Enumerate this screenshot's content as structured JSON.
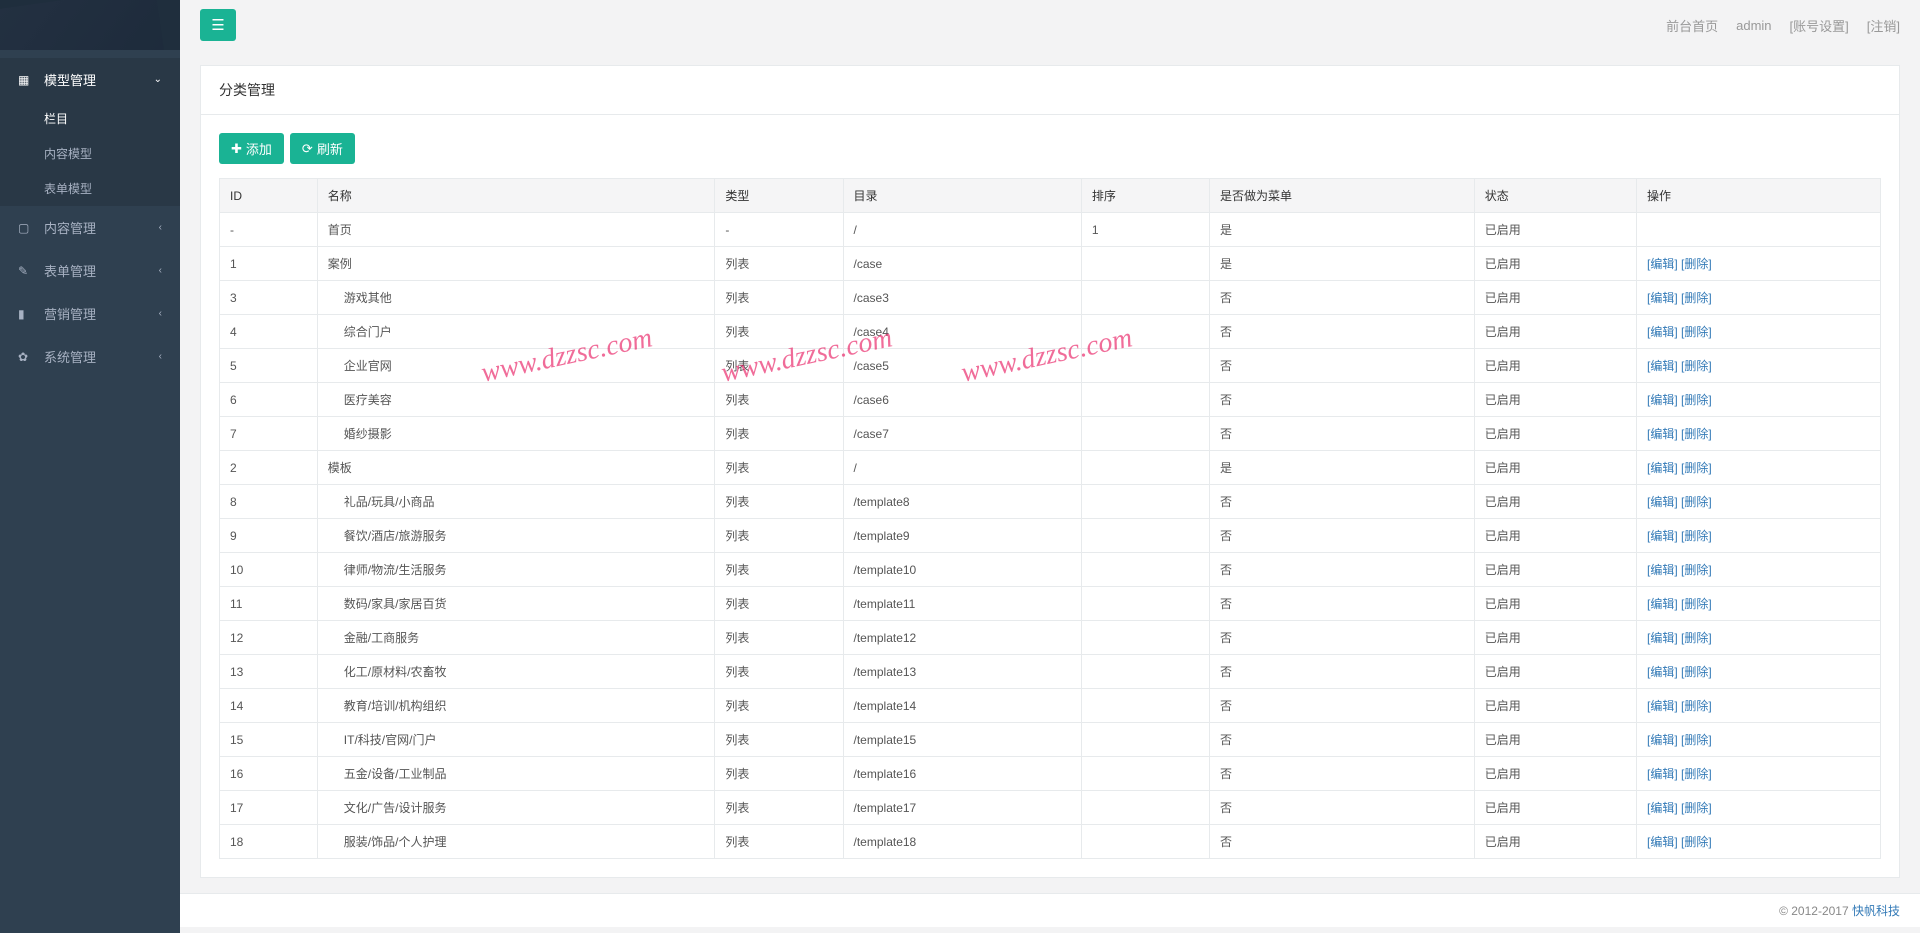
{
  "sidebar": {
    "items": [
      {
        "label": "模型管理",
        "icon": "grid",
        "expanded": true,
        "children": [
          {
            "label": "栏目",
            "active": true
          },
          {
            "label": "内容模型"
          },
          {
            "label": "表单模型"
          }
        ]
      },
      {
        "label": "内容管理",
        "icon": "doc"
      },
      {
        "label": "表单管理",
        "icon": "edit"
      },
      {
        "label": "营销管理",
        "icon": "chart"
      },
      {
        "label": "系统管理",
        "icon": "gear"
      }
    ]
  },
  "topbar": {
    "links": [
      {
        "label": "前台首页"
      },
      {
        "label": "admin"
      },
      {
        "label": "[账号设置]"
      },
      {
        "label": "[注销]"
      }
    ]
  },
  "panel": {
    "title": "分类管理"
  },
  "toolbar": {
    "add_label": "添加",
    "refresh_label": "刷新"
  },
  "table": {
    "headers": [
      "ID",
      "名称",
      "类型",
      "目录",
      "排序",
      "是否做为菜单",
      "状态",
      "操作"
    ],
    "edit_label": "[编辑]",
    "delete_label": "[删除]",
    "rows": [
      {
        "id": "-",
        "name": "首页",
        "indent": 0,
        "type": "-",
        "dir": "/",
        "sort": "1",
        "menu": "是",
        "status": "已启用",
        "actions": false
      },
      {
        "id": "1",
        "name": "案例",
        "indent": 0,
        "type": "列表",
        "dir": "/case",
        "sort": "",
        "menu": "是",
        "status": "已启用",
        "actions": true
      },
      {
        "id": "3",
        "name": "游戏其他",
        "indent": 1,
        "type": "列表",
        "dir": "/case3",
        "sort": "",
        "menu": "否",
        "status": "已启用",
        "actions": true
      },
      {
        "id": "4",
        "name": "综合门户",
        "indent": 1,
        "type": "列表",
        "dir": "/case4",
        "sort": "",
        "menu": "否",
        "status": "已启用",
        "actions": true
      },
      {
        "id": "5",
        "name": "企业官网",
        "indent": 1,
        "type": "列表",
        "dir": "/case5",
        "sort": "",
        "menu": "否",
        "status": "已启用",
        "actions": true
      },
      {
        "id": "6",
        "name": "医疗美容",
        "indent": 1,
        "type": "列表",
        "dir": "/case6",
        "sort": "",
        "menu": "否",
        "status": "已启用",
        "actions": true
      },
      {
        "id": "7",
        "name": "婚纱摄影",
        "indent": 1,
        "type": "列表",
        "dir": "/case7",
        "sort": "",
        "menu": "否",
        "status": "已启用",
        "actions": true
      },
      {
        "id": "2",
        "name": "模板",
        "indent": 0,
        "type": "列表",
        "dir": "/",
        "sort": "",
        "menu": "是",
        "status": "已启用",
        "actions": true
      },
      {
        "id": "8",
        "name": "礼品/玩具/小商品",
        "indent": 1,
        "type": "列表",
        "dir": "/template8",
        "sort": "",
        "menu": "否",
        "status": "已启用",
        "actions": true
      },
      {
        "id": "9",
        "name": "餐饮/酒店/旅游服务",
        "indent": 1,
        "type": "列表",
        "dir": "/template9",
        "sort": "",
        "menu": "否",
        "status": "已启用",
        "actions": true
      },
      {
        "id": "10",
        "name": "律师/物流/生活服务",
        "indent": 1,
        "type": "列表",
        "dir": "/template10",
        "sort": "",
        "menu": "否",
        "status": "已启用",
        "actions": true
      },
      {
        "id": "11",
        "name": "数码/家具/家居百货",
        "indent": 1,
        "type": "列表",
        "dir": "/template11",
        "sort": "",
        "menu": "否",
        "status": "已启用",
        "actions": true
      },
      {
        "id": "12",
        "name": "金融/工商服务",
        "indent": 1,
        "type": "列表",
        "dir": "/template12",
        "sort": "",
        "menu": "否",
        "status": "已启用",
        "actions": true
      },
      {
        "id": "13",
        "name": "化工/原材料/农畜牧",
        "indent": 1,
        "type": "列表",
        "dir": "/template13",
        "sort": "",
        "menu": "否",
        "status": "已启用",
        "actions": true
      },
      {
        "id": "14",
        "name": "教育/培训/机构组织",
        "indent": 1,
        "type": "列表",
        "dir": "/template14",
        "sort": "",
        "menu": "否",
        "status": "已启用",
        "actions": true
      },
      {
        "id": "15",
        "name": "IT/科技/官网/门户",
        "indent": 1,
        "type": "列表",
        "dir": "/template15",
        "sort": "",
        "menu": "否",
        "status": "已启用",
        "actions": true
      },
      {
        "id": "16",
        "name": "五金/设备/工业制品",
        "indent": 1,
        "type": "列表",
        "dir": "/template16",
        "sort": "",
        "menu": "否",
        "status": "已启用",
        "actions": true
      },
      {
        "id": "17",
        "name": "文化/广告/设计服务",
        "indent": 1,
        "type": "列表",
        "dir": "/template17",
        "sort": "",
        "menu": "否",
        "status": "已启用",
        "actions": true
      },
      {
        "id": "18",
        "name": "服装/饰品/个人护理",
        "indent": 1,
        "type": "列表",
        "dir": "/template18",
        "sort": "",
        "menu": "否",
        "status": "已启用",
        "actions": true
      }
    ]
  },
  "footer": {
    "copyright": "© 2012-2017",
    "brand": "快帆科技"
  },
  "watermark": "www.dzzsc.com"
}
